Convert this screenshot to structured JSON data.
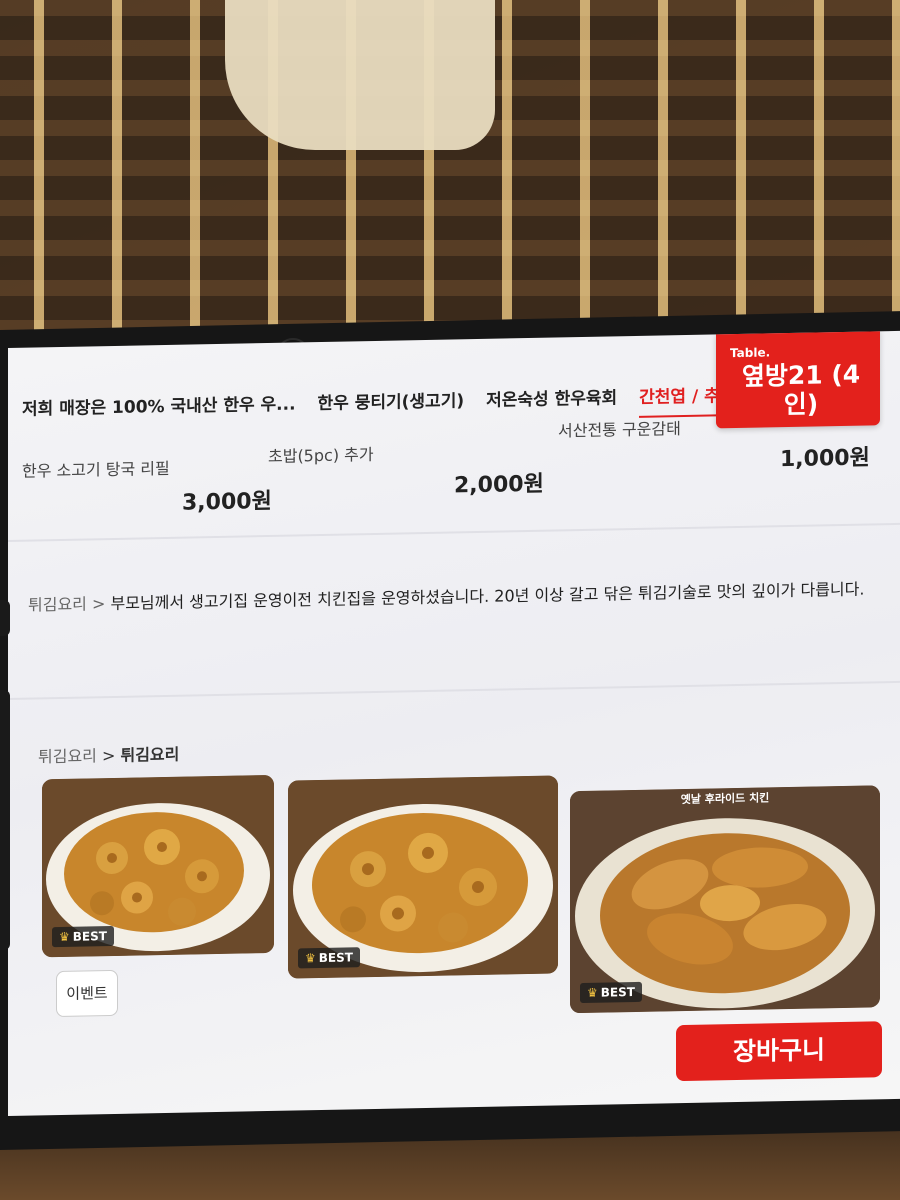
{
  "header": {
    "tabs": [
      {
        "label": "저희 매장은 100% 국내산 한우 우...",
        "active": false
      },
      {
        "label": "한우 뭉티기(생고기)",
        "active": false
      },
      {
        "label": "저온숙성 한우육회",
        "active": false
      },
      {
        "label": "간천엽 / 추가",
        "active": true
      }
    ],
    "table_label": "Table.",
    "table_value": "옆방21 (4인)"
  },
  "items": [
    {
      "name": "한우 소고기 탕국 리필",
      "price": "3,000원"
    },
    {
      "name": "초밥(5pc) 추가",
      "price": "2,000원"
    },
    {
      "name": "서산전통 구운감태",
      "price": "1,000원"
    }
  ],
  "category_description": {
    "category": "튀김요리",
    "separator": ">",
    "text": "부모님께서 생고기집 운영이전 치킨집을 운영하셨습니다. 20년 이상 갈고 닦은 튀김기술로 맛의 깊이가 다릅니다."
  },
  "breadcrumb": {
    "parent": "튀김요리",
    "separator": ">",
    "current": "튀김요리"
  },
  "menu_cards": [
    {
      "badge": "BEST",
      "caption": ""
    },
    {
      "badge": "BEST",
      "caption": ""
    },
    {
      "badge": "BEST",
      "caption": "옛날 후라이드 치킨"
    }
  ],
  "buttons": {
    "event": "이벤트",
    "cart": "장바구니"
  },
  "colors": {
    "accent": "#e3211c",
    "active_tab": "#e02020"
  }
}
